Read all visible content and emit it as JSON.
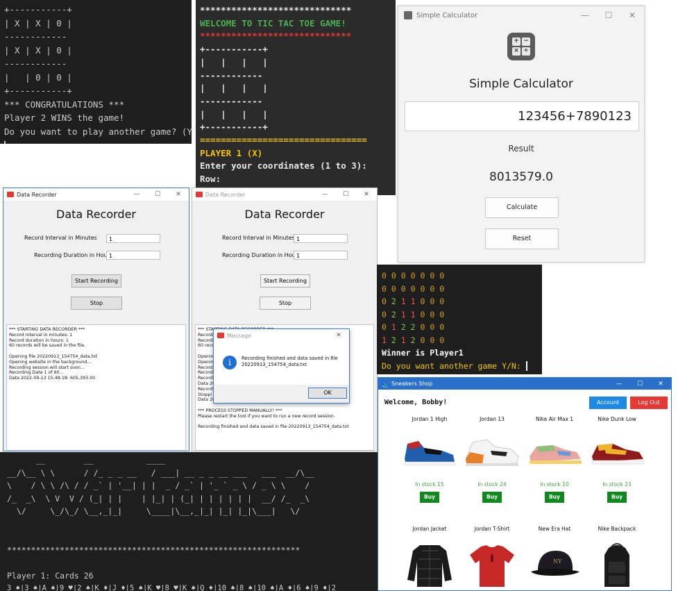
{
  "terminal_tictactoe": {
    "lines": [
      "+-----------+",
      "| X | X | 0 |",
      "------------",
      "| X | X | 0 |",
      "------------",
      "|   | 0 | 0 |",
      "+-----------+",
      "*** CONGRATULATIONS ***",
      "Player 2 WINS the game!",
      "Do you want to play another game? (Y/N)"
    ]
  },
  "tictactoe_welcome": {
    "stars_top": "*****************************",
    "welcome": "WELCOME TO TIC TAC TOE GAME!",
    "stars_bottom": "*****************************",
    "board": [
      "+-----------+",
      "|   |   |   |",
      "------------",
      "|   |   |   |",
      "------------",
      "|   |   |   |",
      "+-----------+"
    ],
    "divider": "================================",
    "player": "PLAYER 1 (X)",
    "prompt": "Enter your coordinates (1 to 3):",
    "row_prompt": "Row:"
  },
  "calculator": {
    "window_title": "Simple Calculator",
    "heading": "Simple Calculator",
    "display_value": "123456+7890123",
    "result_label": "Result",
    "result_value": "8013579.0",
    "calculate_label": "Calculate",
    "reset_label": "Reset",
    "logo_symbols": [
      "+",
      "−",
      "×",
      "÷"
    ]
  },
  "data_recorder_1": {
    "window_title": "Data Recorder",
    "heading": "Data Recorder",
    "interval_label": "Record Interval in Minutes",
    "interval_value": "1",
    "duration_label": "Recording Duration in Hours",
    "duration_value": "1",
    "start_label": "Start Recording",
    "stop_label": "Stop",
    "log": "*** STARTING DATA RECORDER ***\nRecord interval in minutes: 1\nRecord duration in hours: 1\n60 records will be saved in the file.\n\nOpening file 20220913_154754_data.txt\nOpening website in the background...\nRecording session will start soon...\nRecording Data 1 of 60...\nData 2022-09-13 15:48:18: 605,393.00"
  },
  "data_recorder_2": {
    "window_title": "Data Recorder",
    "heading": "Data Recorder",
    "interval_label": "Record Interval in Minutes",
    "interval_value": "1",
    "duration_label": "Recording Duration in Hours",
    "duration_value": "1",
    "start_label": "Start Recording",
    "stop_label": "Stop",
    "log": "*** STARTING DATA RECORDER ***\nRecord\nRecord\n60 reco\n\nOpenin\nOpenin\nRecord\nRecord\nRecord\nData 20\nRecord\nStoppi\nData 2022-09-13 15:49:37: 645,369.00\n\n*** PROCESS STOPPED MANUALLY! ***\nPlease restart the tool if you want to run a new record session.\n\nRecording finished and data saved in file 20220913_154754_data.txt",
    "message_title": "Message",
    "message_text": "Recording finished and data saved in file 20220913_154754_data.txt",
    "ok_label": "OK"
  },
  "connect4": {
    "rows": [
      [
        "0",
        "0",
        "0",
        "0",
        "0",
        "0",
        "0"
      ],
      [
        "0",
        "0",
        "0",
        "0",
        "0",
        "0",
        "0"
      ],
      [
        "0",
        "2",
        "1",
        "1",
        "0",
        "0",
        "0"
      ],
      [
        "0",
        "2",
        "1",
        "1",
        "0",
        "0",
        "0"
      ],
      [
        "0",
        "1",
        "2",
        "2",
        "0",
        "0",
        "0"
      ],
      [
        "1",
        "2",
        "1",
        "2",
        "0",
        "0",
        "0"
      ]
    ],
    "winner": "Winner is Player1",
    "prompt": "Do you want another game Y/N:"
  },
  "sneakers_shop": {
    "window_title": "Sneakers Shop",
    "welcome": "Welcome, Bobby!",
    "account_label": "Account",
    "logout_label": "Log Out",
    "products": [
      {
        "name": "Jordan 1 High",
        "stock": "In stock 15",
        "buy": "Buy"
      },
      {
        "name": "Jordan 13",
        "stock": "In stock 24",
        "buy": "Buy"
      },
      {
        "name": "Nike Air Max 1",
        "stock": "In stock 10",
        "buy": "Buy"
      },
      {
        "name": "Nike Dunk Low",
        "stock": "In stock 23",
        "buy": "Buy"
      },
      {
        "name": "Jordan Jacket"
      },
      {
        "name": "Jordan T-Shirt"
      },
      {
        "name": "New Era Hat"
      },
      {
        "name": "Nike Backpack"
      }
    ],
    "colors": {
      "titlebar": "#2a6fc9",
      "account": "#1e88e5",
      "logout": "#e53935",
      "buy": "#108a1e",
      "stock": "#43a047"
    }
  },
  "war_game": {
    "ascii_banner": [
      "      __        __           ____",
      "__/\\__ \\ \\      / /_ _ _ __   / ___| __ _ _ __ ___   ___  __/\\__",
      "\\    / \\ \\ /\\ / / _` | '__| | |  _ / _` | '_ ` _ \\ / _ \\ \\    /",
      "/_  _\\  \\ V  V / (_| | |    | |_| | (_| | | | | | |  __/ /_  _\\",
      "  \\/     \\_/\\_/ \\__,_|_|     \\____|\\__,_|_| |_| |_|\\___|   \\/"
    ],
    "stars": "*************************************************************",
    "player_line": "Player 1: Cards 26",
    "cards_line": "3 ♠|3 ♠|A ♠|9 ♥|2 ♠|K ♦|J ♦|5 ♠|K ♥|8 ♥|K ♠|Q ♦|10 ♠|8 ♠|10 ♠|A ♦|6 ♠|9 ♦|2"
  }
}
